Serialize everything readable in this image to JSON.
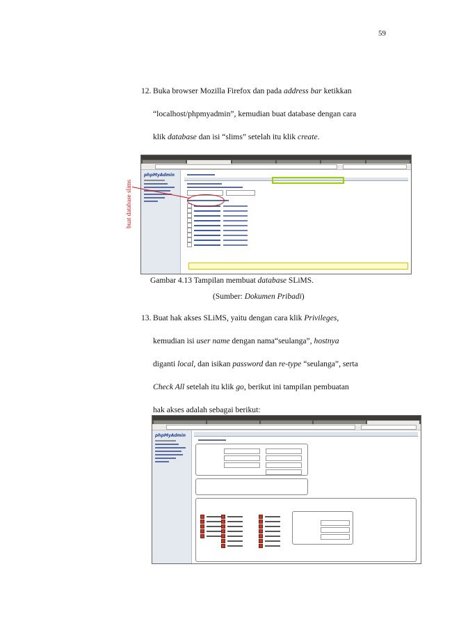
{
  "page_number": "59",
  "step12": {
    "number": "12.",
    "line1_pre": "Buka browser Mozilla Firefox dan pada ",
    "line1_em": "address bar",
    "line1_post": " ketikkan",
    "line2": "“localhost/phpmyadmin”, kemudian buat database dengan cara",
    "line3_pre": "klik ",
    "line3_em1": "database",
    "line3_mid": " dan isi “slims” setelah itu klik ",
    "line3_em2": "create",
    "line3_post": "."
  },
  "figure1": {
    "side_label": "buat database slims",
    "caption_pre": "Gambar 4.13 Tampilan membuat ",
    "caption_em": "database",
    "caption_post": " SLiMS.",
    "source_pre": "(Sumber: ",
    "source_em": "Dokumen Pribadi",
    "source_post": ")"
  },
  "step13": {
    "number": "13.",
    "line1_pre": "Buat hak akses SLiMS, yaitu dengan cara klik ",
    "line1_em": "Privileges",
    "line1_post": ",",
    "line2_pre": "kemudian isi ",
    "line2_em1": "user name",
    "line2_mid": " dengan nama“seulanga”, ",
    "line2_em2": "hostnya",
    "line3_pre": "diganti ",
    "line3_em1": "local",
    "line3_mid1": ", dan isikan ",
    "line3_em2": "password",
    "line3_mid2": " dan ",
    "line3_em3": "re-type",
    "line3_post": " “seulanga”, serta",
    "line4_em1": "Check All",
    "line4_mid": " setelah itu klik ",
    "line4_em2": "go",
    "line4_post": ", berikut ini tampilan pembuatan",
    "line5": "hak akses adalah sebagai berikut:"
  }
}
